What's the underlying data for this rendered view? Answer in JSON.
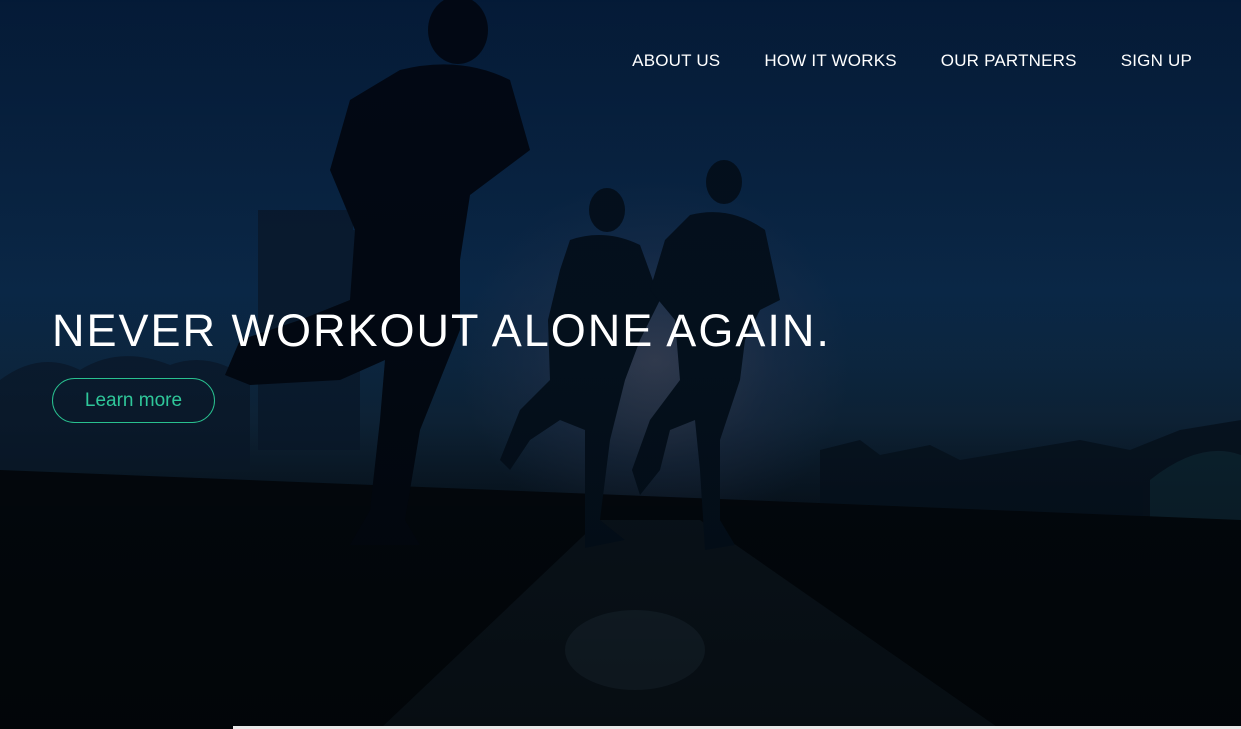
{
  "nav": {
    "items": [
      {
        "label": "ABOUT US"
      },
      {
        "label": "HOW IT WORKS"
      },
      {
        "label": "OUR PARTNERS"
      },
      {
        "label": "SIGN UP"
      }
    ]
  },
  "hero": {
    "headline": "NEVER WORKOUT ALONE AGAIN.",
    "cta_label": "Learn more",
    "background_image": "silhouettes-of-runners-at-dusk",
    "accent_color": "#2fc79a"
  }
}
